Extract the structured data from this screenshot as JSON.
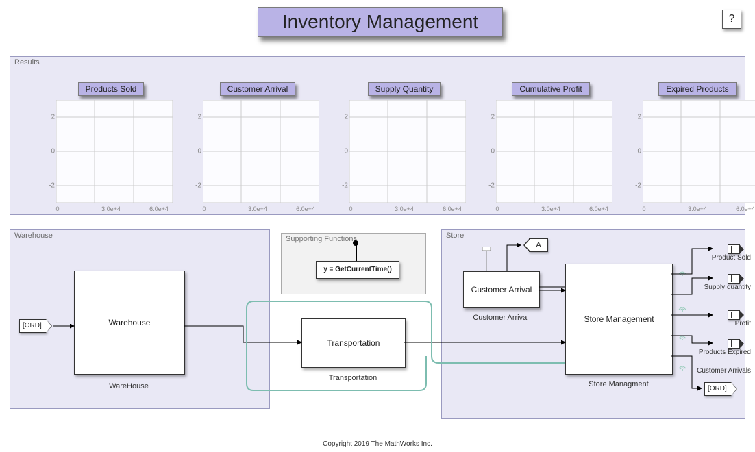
{
  "title": "Inventory Management",
  "help_label": "?",
  "copyright": "Copyright 2019 The MathWorks Inc.",
  "results": {
    "panel_label": "Results",
    "charts": [
      {
        "title": "Products Sold"
      },
      {
        "title": "Customer Arrival"
      },
      {
        "title": "Supply Quantity"
      },
      {
        "title": "Cumulative Profit"
      },
      {
        "title": "Expired Products"
      }
    ],
    "yticks": [
      "2",
      "0",
      "-2"
    ],
    "xticks": [
      "0",
      "3.0e+4",
      "6.0e+4"
    ]
  },
  "warehouse": {
    "panel_label": "Warehouse",
    "block_label": "Warehouse",
    "under_label": "WareHouse",
    "ord_tag": "[ORD]"
  },
  "supporting": {
    "panel_label": "Supporting Functions",
    "fn_text": "y = GetCurrentTime()"
  },
  "transportation": {
    "block_label": "Transportation",
    "under_label": "Transportation"
  },
  "store": {
    "panel_label": "Store",
    "customer_block": "Customer Arrival",
    "customer_under": "Customer Arrival",
    "mgmt_block": "Store Management",
    "mgmt_under": "Store Managment",
    "a_tag": "A",
    "ord_tag": "[ORD]",
    "outputs": [
      "Product Sold",
      "Supply quantity",
      "Profit",
      "Products Expired",
      "Customer Arrivals"
    ]
  },
  "chart_data": [
    {
      "type": "line",
      "title": "Products Sold",
      "xlim": [
        0,
        60000
      ],
      "ylim": [
        -3,
        3
      ],
      "series": [],
      "xticks": [
        0,
        30000,
        60000
      ],
      "yticks": [
        -2,
        0,
        2
      ]
    },
    {
      "type": "line",
      "title": "Customer Arrival",
      "xlim": [
        0,
        60000
      ],
      "ylim": [
        -3,
        3
      ],
      "series": [],
      "xticks": [
        0,
        30000,
        60000
      ],
      "yticks": [
        -2,
        0,
        2
      ]
    },
    {
      "type": "line",
      "title": "Supply Quantity",
      "xlim": [
        0,
        60000
      ],
      "ylim": [
        -3,
        3
      ],
      "series": [],
      "xticks": [
        0,
        30000,
        60000
      ],
      "yticks": [
        -2,
        0,
        2
      ]
    },
    {
      "type": "line",
      "title": "Cumulative Profit",
      "xlim": [
        0,
        60000
      ],
      "ylim": [
        -3,
        3
      ],
      "series": [],
      "xticks": [
        0,
        30000,
        60000
      ],
      "yticks": [
        -2,
        0,
        2
      ]
    },
    {
      "type": "line",
      "title": "Expired Products",
      "xlim": [
        0,
        60000
      ],
      "ylim": [
        -3,
        3
      ],
      "series": [],
      "xticks": [
        0,
        30000,
        60000
      ],
      "yticks": [
        -2,
        0,
        2
      ]
    }
  ]
}
